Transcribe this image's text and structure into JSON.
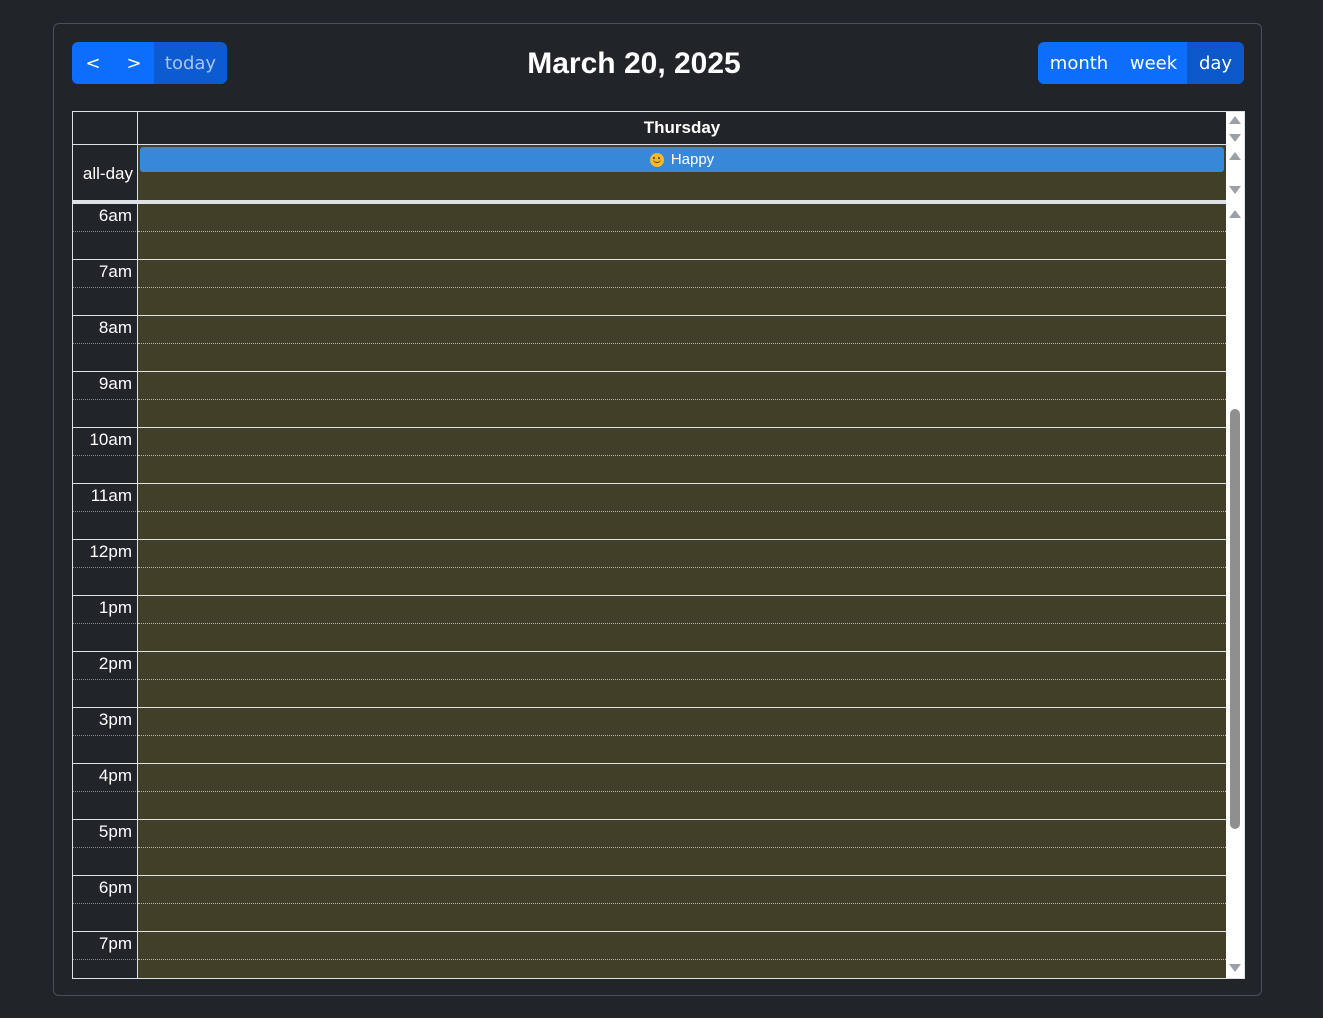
{
  "toolbar": {
    "prev_label": "<",
    "next_label": ">",
    "today_label": "today",
    "title": "March 20, 2025",
    "views": [
      "month",
      "week",
      "day"
    ],
    "active_view": "day"
  },
  "calendar": {
    "day_header": "Thursday",
    "allday_label": "all-day",
    "allday_event": "Happy",
    "time_slots": [
      "6am",
      "7am",
      "8am",
      "9am",
      "10am",
      "11am",
      "12pm",
      "1pm",
      "2pm",
      "3pm",
      "4pm",
      "5pm",
      "6pm",
      "7pm"
    ]
  },
  "colors": {
    "page_background": "#212529",
    "slot_background": "#423f29",
    "button": "#0d6efd",
    "button_active": "#0a58ca",
    "event": "#3788d8"
  }
}
